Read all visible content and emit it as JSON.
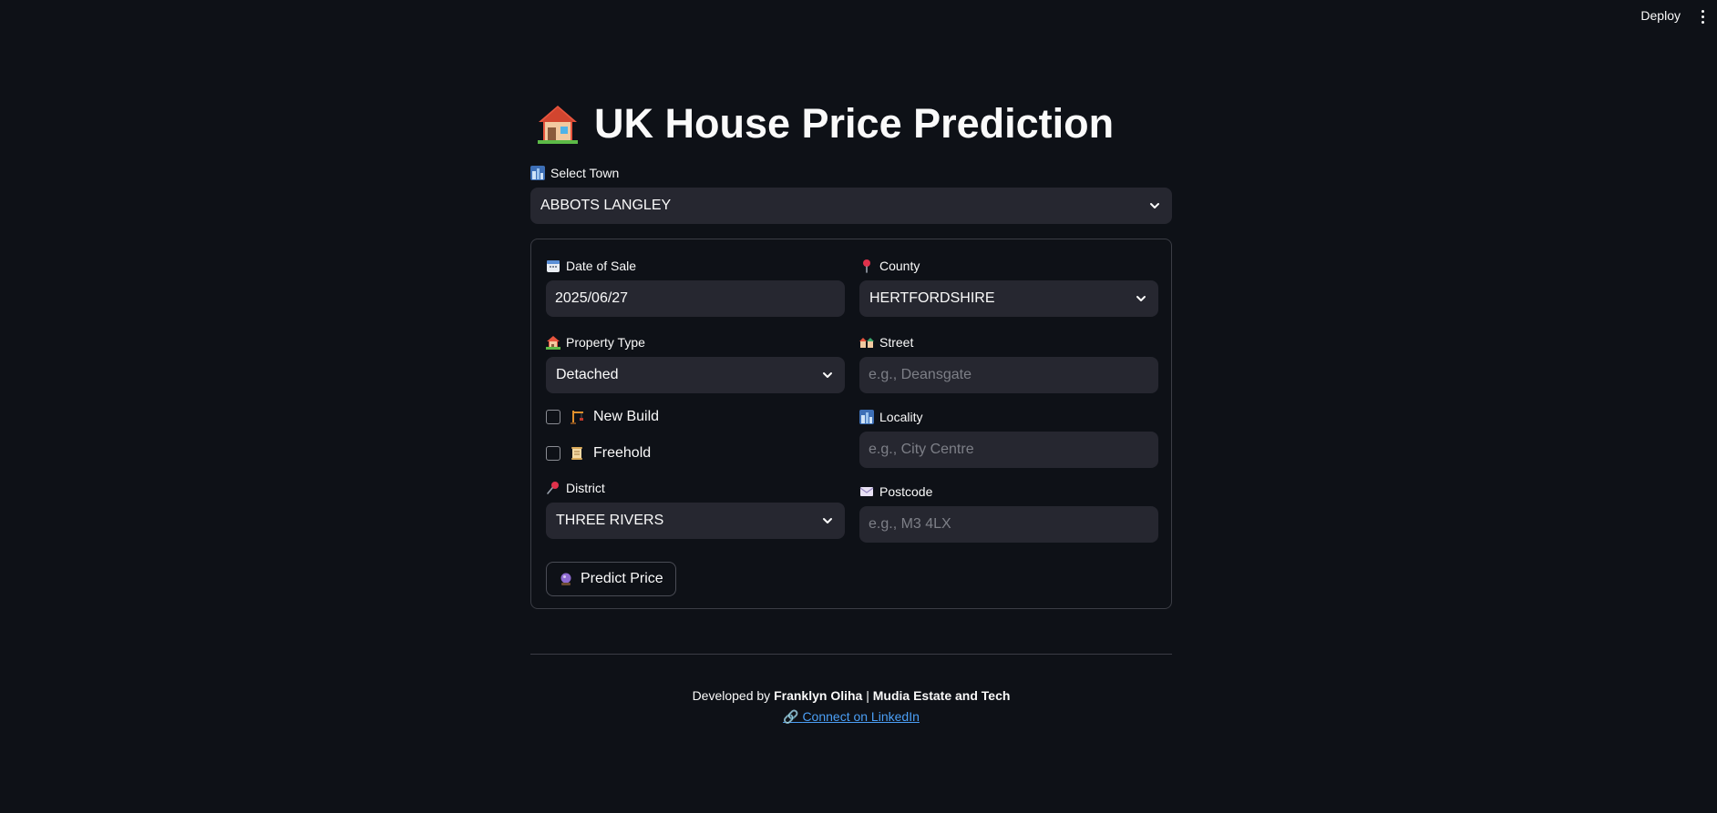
{
  "header": {
    "deploy_label": "Deploy"
  },
  "page": {
    "title": "UK House Price Prediction"
  },
  "town": {
    "label": "Select Town",
    "value": "ABBOTS LANGLEY"
  },
  "form": {
    "date": {
      "label": "Date of Sale",
      "value": "2025/06/27"
    },
    "county": {
      "label": "County",
      "value": "HERTFORDSHIRE"
    },
    "property_type": {
      "label": "Property Type",
      "value": "Detached"
    },
    "street": {
      "label": "Street",
      "placeholder": "e.g., Deansgate"
    },
    "new_build": {
      "label": "New Build",
      "checked": false
    },
    "freehold": {
      "label": "Freehold",
      "checked": false
    },
    "locality": {
      "label": "Locality",
      "placeholder": "e.g., City Centre"
    },
    "district": {
      "label": "District",
      "value": "THREE RIVERS"
    },
    "postcode": {
      "label": "Postcode",
      "placeholder": "e.g., M3 4LX"
    },
    "predict_label": "Predict Price"
  },
  "footer": {
    "prefix": "Developed by ",
    "author": "Franklyn Oliha",
    "separator": " | ",
    "company": "Mudia Estate and Tech",
    "link_label": "Connect on LinkedIn"
  }
}
